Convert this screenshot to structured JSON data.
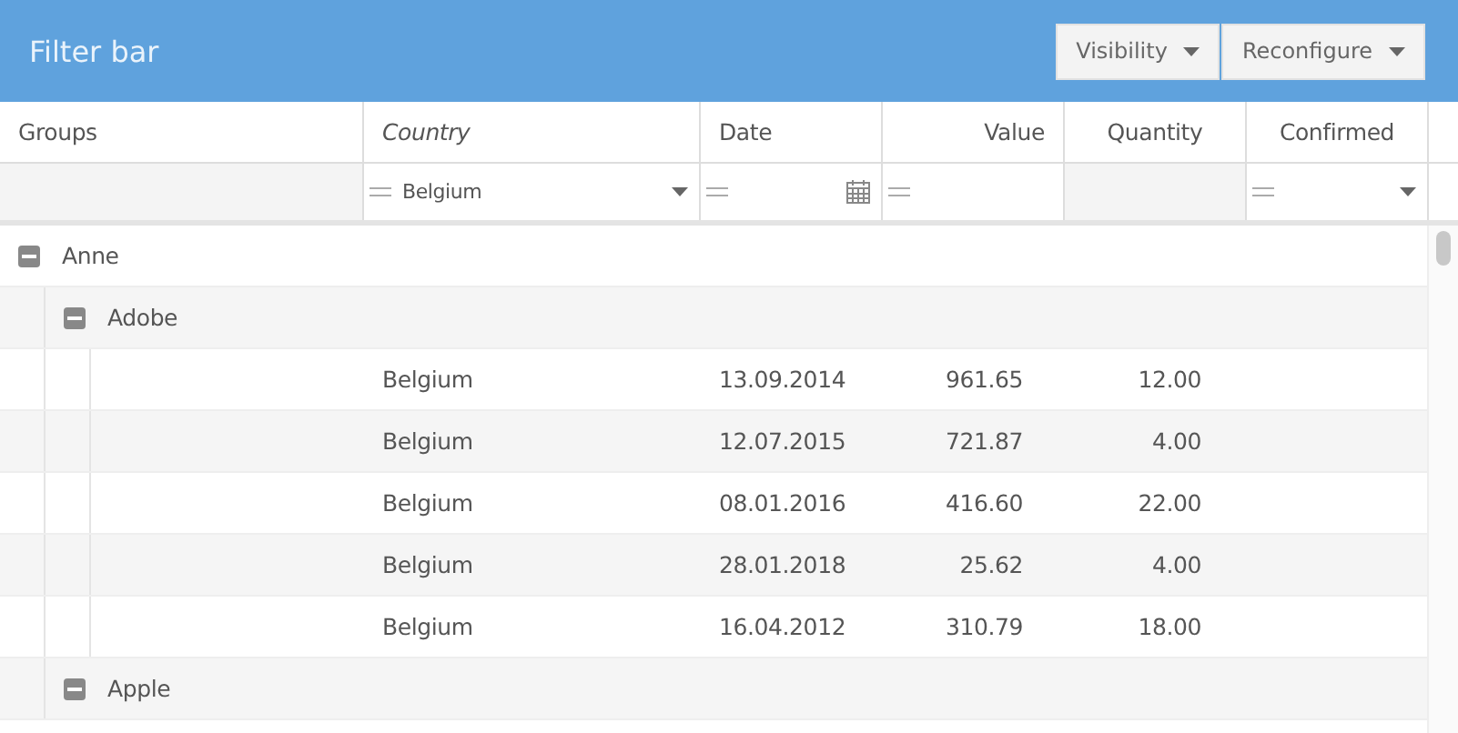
{
  "title": "Filter bar",
  "toolbar": [
    {
      "label": "Visibility"
    },
    {
      "label": "Reconfigure"
    }
  ],
  "columns": [
    {
      "label": "Groups",
      "filtered": false
    },
    {
      "label": "Country",
      "filtered": true
    },
    {
      "label": "Date",
      "filtered": false
    },
    {
      "label": "Value",
      "filtered": false
    },
    {
      "label": "Quantity",
      "filtered": false
    },
    {
      "label": "Confirmed",
      "filtered": false
    }
  ],
  "filters": [
    {
      "kind": "none"
    },
    {
      "kind": "select",
      "value": "Belgium"
    },
    {
      "kind": "date"
    },
    {
      "kind": "text"
    },
    {
      "kind": "none"
    },
    {
      "kind": "select"
    }
  ],
  "groups": [
    {
      "label": "Anne",
      "expanded": true,
      "children": [
        {
          "label": "Adobe",
          "expanded": true,
          "rows": [
            {
              "country": "Belgium",
              "date": "13.09.2014",
              "value": "961.65",
              "quantity": "12.00"
            },
            {
              "country": "Belgium",
              "date": "12.07.2015",
              "value": "721.87",
              "quantity": "4.00"
            },
            {
              "country": "Belgium",
              "date": "08.01.2016",
              "value": "416.60",
              "quantity": "22.00"
            },
            {
              "country": "Belgium",
              "date": "28.01.2018",
              "value": "25.62",
              "quantity": "4.00"
            },
            {
              "country": "Belgium",
              "date": "16.04.2012",
              "value": "310.79",
              "quantity": "18.00"
            }
          ]
        },
        {
          "label": "Apple",
          "expanded": true
        }
      ]
    }
  ]
}
